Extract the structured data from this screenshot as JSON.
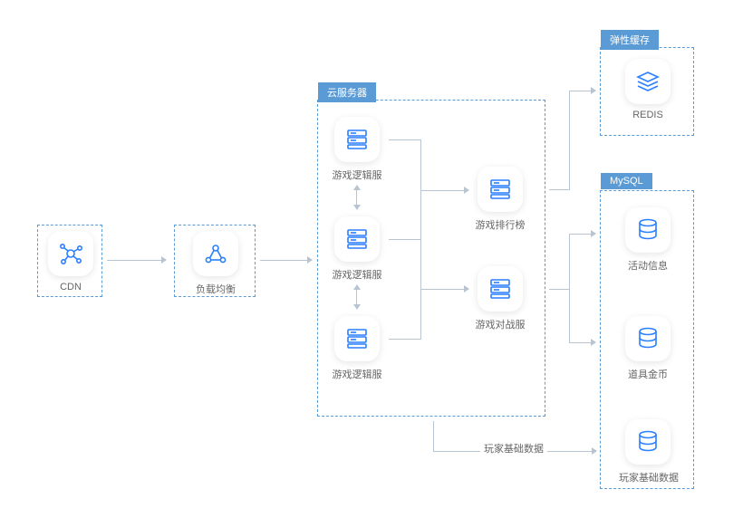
{
  "groups": {
    "cloud": {
      "title": "云服务器"
    },
    "redis": {
      "title": "弹性缓存"
    },
    "mysql": {
      "title": "MySQL"
    }
  },
  "nodes": {
    "cdn": {
      "label": "CDN"
    },
    "lb": {
      "label": "负载均衡"
    },
    "logic1": {
      "label": "游戏逻辑服"
    },
    "logic2": {
      "label": "游戏逻辑服"
    },
    "logic3": {
      "label": "游戏逻辑服"
    },
    "rank": {
      "label": "游戏排行榜"
    },
    "battle": {
      "label": "游戏对战服"
    },
    "redis": {
      "label": "REDIS"
    },
    "act": {
      "label": "活动信息"
    },
    "gold": {
      "label": "道具金币"
    },
    "player": {
      "label": "玩家基础数据"
    }
  },
  "edges": {
    "playerData": {
      "label": "玩家基础数据"
    }
  },
  "colors": {
    "accent": "#5b9bd5",
    "icon": "#2a7fff"
  }
}
